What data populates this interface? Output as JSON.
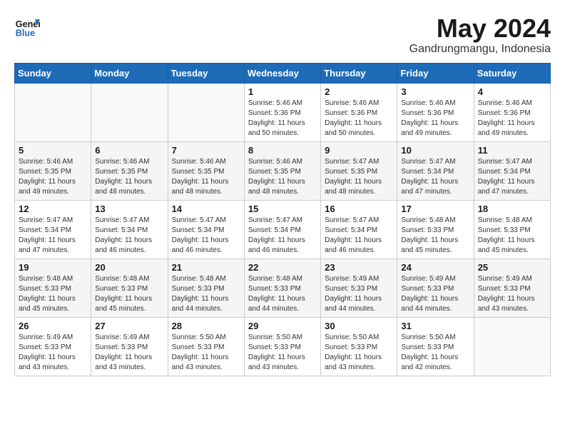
{
  "header": {
    "logo_line1": "General",
    "logo_line2": "Blue",
    "month": "May 2024",
    "location": "Gandrungmangu, Indonesia"
  },
  "weekdays": [
    "Sunday",
    "Monday",
    "Tuesday",
    "Wednesday",
    "Thursday",
    "Friday",
    "Saturday"
  ],
  "weeks": [
    [
      {
        "day": "",
        "info": ""
      },
      {
        "day": "",
        "info": ""
      },
      {
        "day": "",
        "info": ""
      },
      {
        "day": "1",
        "info": "Sunrise: 5:46 AM\nSunset: 5:36 PM\nDaylight: 11 hours\nand 50 minutes."
      },
      {
        "day": "2",
        "info": "Sunrise: 5:46 AM\nSunset: 5:36 PM\nDaylight: 11 hours\nand 50 minutes."
      },
      {
        "day": "3",
        "info": "Sunrise: 5:46 AM\nSunset: 5:36 PM\nDaylight: 11 hours\nand 49 minutes."
      },
      {
        "day": "4",
        "info": "Sunrise: 5:46 AM\nSunset: 5:36 PM\nDaylight: 11 hours\nand 49 minutes."
      }
    ],
    [
      {
        "day": "5",
        "info": "Sunrise: 5:46 AM\nSunset: 5:35 PM\nDaylight: 11 hours\nand 49 minutes."
      },
      {
        "day": "6",
        "info": "Sunrise: 5:46 AM\nSunset: 5:35 PM\nDaylight: 11 hours\nand 48 minutes."
      },
      {
        "day": "7",
        "info": "Sunrise: 5:46 AM\nSunset: 5:35 PM\nDaylight: 11 hours\nand 48 minutes."
      },
      {
        "day": "8",
        "info": "Sunrise: 5:46 AM\nSunset: 5:35 PM\nDaylight: 11 hours\nand 48 minutes."
      },
      {
        "day": "9",
        "info": "Sunrise: 5:47 AM\nSunset: 5:35 PM\nDaylight: 11 hours\nand 48 minutes."
      },
      {
        "day": "10",
        "info": "Sunrise: 5:47 AM\nSunset: 5:34 PM\nDaylight: 11 hours\nand 47 minutes."
      },
      {
        "day": "11",
        "info": "Sunrise: 5:47 AM\nSunset: 5:34 PM\nDaylight: 11 hours\nand 47 minutes."
      }
    ],
    [
      {
        "day": "12",
        "info": "Sunrise: 5:47 AM\nSunset: 5:34 PM\nDaylight: 11 hours\nand 47 minutes."
      },
      {
        "day": "13",
        "info": "Sunrise: 5:47 AM\nSunset: 5:34 PM\nDaylight: 11 hours\nand 46 minutes."
      },
      {
        "day": "14",
        "info": "Sunrise: 5:47 AM\nSunset: 5:34 PM\nDaylight: 11 hours\nand 46 minutes."
      },
      {
        "day": "15",
        "info": "Sunrise: 5:47 AM\nSunset: 5:34 PM\nDaylight: 11 hours\nand 46 minutes."
      },
      {
        "day": "16",
        "info": "Sunrise: 5:47 AM\nSunset: 5:34 PM\nDaylight: 11 hours\nand 46 minutes."
      },
      {
        "day": "17",
        "info": "Sunrise: 5:48 AM\nSunset: 5:33 PM\nDaylight: 11 hours\nand 45 minutes."
      },
      {
        "day": "18",
        "info": "Sunrise: 5:48 AM\nSunset: 5:33 PM\nDaylight: 11 hours\nand 45 minutes."
      }
    ],
    [
      {
        "day": "19",
        "info": "Sunrise: 5:48 AM\nSunset: 5:33 PM\nDaylight: 11 hours\nand 45 minutes."
      },
      {
        "day": "20",
        "info": "Sunrise: 5:48 AM\nSunset: 5:33 PM\nDaylight: 11 hours\nand 45 minutes."
      },
      {
        "day": "21",
        "info": "Sunrise: 5:48 AM\nSunset: 5:33 PM\nDaylight: 11 hours\nand 44 minutes."
      },
      {
        "day": "22",
        "info": "Sunrise: 5:48 AM\nSunset: 5:33 PM\nDaylight: 11 hours\nand 44 minutes."
      },
      {
        "day": "23",
        "info": "Sunrise: 5:49 AM\nSunset: 5:33 PM\nDaylight: 11 hours\nand 44 minutes."
      },
      {
        "day": "24",
        "info": "Sunrise: 5:49 AM\nSunset: 5:33 PM\nDaylight: 11 hours\nand 44 minutes."
      },
      {
        "day": "25",
        "info": "Sunrise: 5:49 AM\nSunset: 5:33 PM\nDaylight: 11 hours\nand 43 minutes."
      }
    ],
    [
      {
        "day": "26",
        "info": "Sunrise: 5:49 AM\nSunset: 5:33 PM\nDaylight: 11 hours\nand 43 minutes."
      },
      {
        "day": "27",
        "info": "Sunrise: 5:49 AM\nSunset: 5:33 PM\nDaylight: 11 hours\nand 43 minutes."
      },
      {
        "day": "28",
        "info": "Sunrise: 5:50 AM\nSunset: 5:33 PM\nDaylight: 11 hours\nand 43 minutes."
      },
      {
        "day": "29",
        "info": "Sunrise: 5:50 AM\nSunset: 5:33 PM\nDaylight: 11 hours\nand 43 minutes."
      },
      {
        "day": "30",
        "info": "Sunrise: 5:50 AM\nSunset: 5:33 PM\nDaylight: 11 hours\nand 43 minutes."
      },
      {
        "day": "31",
        "info": "Sunrise: 5:50 AM\nSunset: 5:33 PM\nDaylight: 11 hours\nand 42 minutes."
      },
      {
        "day": "",
        "info": ""
      }
    ]
  ]
}
